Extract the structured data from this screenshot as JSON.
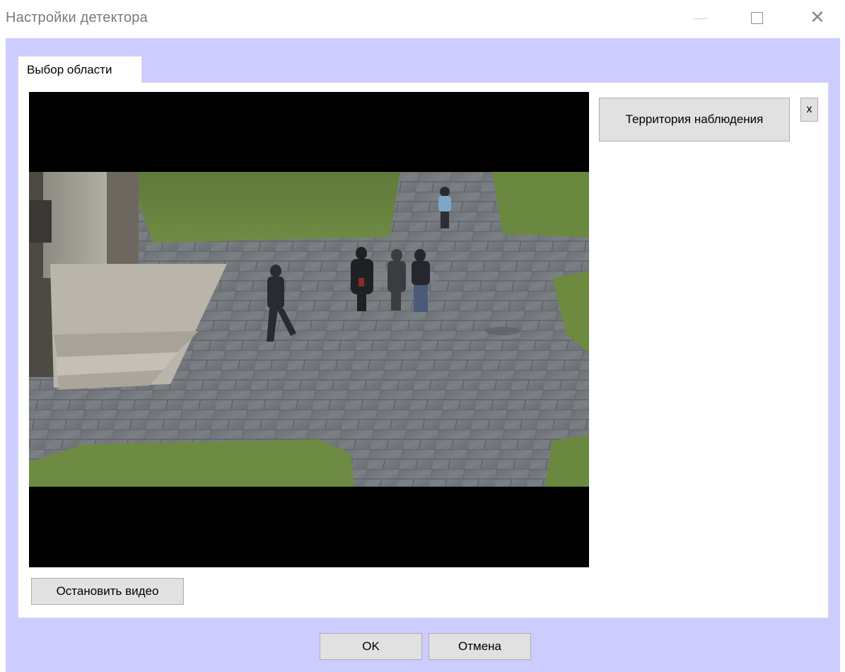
{
  "window": {
    "title": "Настройки детектора",
    "controls": {
      "minimize_icon": "minimize-icon",
      "maximize_icon": "maximize-icon",
      "close_icon": "close-icon",
      "close_glyph": "✕"
    }
  },
  "tabs": [
    {
      "label": "Выбор области",
      "selected": true
    }
  ],
  "video": {
    "description_icon": "camera-feed"
  },
  "areas": [
    {
      "label": "Территория наблюдения",
      "remove_label": "x"
    }
  ],
  "buttons": {
    "stop_video": "Остановить видео",
    "ok": "OK",
    "cancel": "Отмена"
  },
  "colors": {
    "client_background": "#ccccff",
    "button_face": "#e1e1e1",
    "button_border": "#adadad",
    "title_text": "#7a7a7a"
  }
}
